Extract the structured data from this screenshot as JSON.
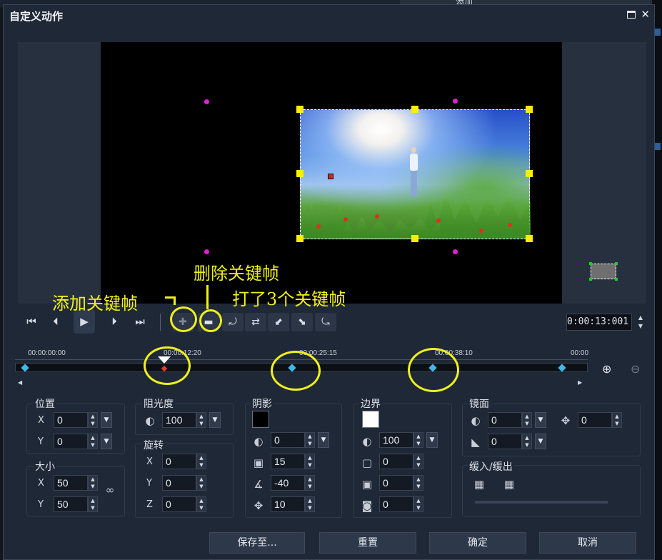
{
  "app": {
    "title": "自定义动作",
    "bg_tab_label": "添加"
  },
  "toolbar": {
    "timecode": "0:00:13:001"
  },
  "timeline": {
    "ticks": [
      "00:00:00:00",
      "00:00:12:20",
      "00:00:25:15",
      "00:00:38:10",
      "00:00"
    ]
  },
  "annotations": {
    "delete_kf": "删除关键帧",
    "add_kf": "添加关键帧",
    "three_kf": "打了3个关键帧"
  },
  "position": {
    "title": "位置",
    "x_label": "X",
    "x": "0",
    "y_label": "Y",
    "y": "0"
  },
  "size": {
    "title": "大小",
    "x_label": "X",
    "x": "50",
    "y_label": "Y",
    "y": "50"
  },
  "opacity": {
    "title": "阻光度",
    "value": "100"
  },
  "rotation": {
    "title": "旋转",
    "x_label": "X",
    "x": "0",
    "y_label": "Y",
    "y": "0",
    "z_label": "Z",
    "z": "0"
  },
  "shadow": {
    "title": "阴影",
    "opacity": "0",
    "blur": "15",
    "angle": "-40",
    "distance": "10",
    "color": "#000000"
  },
  "border": {
    "title": "边界",
    "opacity": "100",
    "width": "0",
    "v2": "0",
    "v3": "0",
    "color": "#ffffff"
  },
  "mirror": {
    "title": "镜面",
    "opacity": "0",
    "offset": "0",
    "fade": "0"
  },
  "ease": {
    "title": "缓入/缓出"
  },
  "buttons": {
    "save_to": "保存至...",
    "reset": "重置",
    "ok": "确定",
    "cancel": "取消"
  }
}
